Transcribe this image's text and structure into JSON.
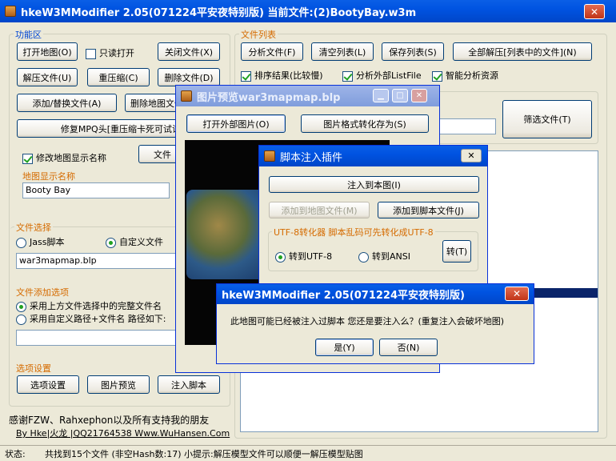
{
  "main": {
    "title": "hkeW3MModifier 2.05(071224平安夜特别版) 当前文件:(2)BootyBay.w3m",
    "close": "✕",
    "func_group": "功能区",
    "open_map": "打开地图(O)",
    "readonly": "只读打开",
    "close_file": "关闭文件(X)",
    "extract_file": "解压文件(U)",
    "recompress": "重压缩(C)",
    "delete_file": "删除文件(D)",
    "add_replace": "添加/替换文件(A)",
    "delete_map_file": "删除地图文件",
    "fix_mpq": "修复MPQ头[重压缩卡死可试试",
    "modify_name": "修改地图显示名称",
    "file_btn": "文件",
    "map_name_label": "地图显示名称",
    "map_name_value": "Booty Bay",
    "file_select_group": "文件选择",
    "jass_script": "Jass脚本",
    "custom_file": "自定义文件",
    "file_select_value": "war3mapmap.blp",
    "add_options_group": "文件添加选项",
    "use_full_name": "采用上方文件选择中的完整文件名",
    "use_custom_path": "采用自定义路径+文件名 路径如下:",
    "options_group": "选项设置",
    "options_btn": "选项设置",
    "image_preview_btn": "图片预览",
    "inject_script_btn": "注入脚本",
    "thanks": "感谢FZW、Rahxephon以及所有支持我的朋友",
    "credit": "By Hke|火龙 |QQ21764538 Www.WuHansen.Com",
    "file_list_group": "文件列表",
    "analyze_file": "分析文件(F)",
    "clear_list": "清空列表(L)",
    "save_list": "保存列表(S)",
    "extract_all": "全部解压[列表中的文件](N)",
    "sort_results": "排序结果(比较慢)",
    "analyze_external": "分析外部ListFile",
    "smart_analyze": "智能分析资源",
    "filter_file": "筛选文件(T)",
    "status_label": "状态:",
    "status_text": "共找到15个文件 (非空Hash数:17) 小提示:解压模型文件可以顺便一解压模型贴图"
  },
  "preview_window": {
    "title": "图片预览war3mapmap.blp",
    "open_external": "打开外部图片(O)",
    "convert_save": "图片格式转化存为(S)"
  },
  "inject_window": {
    "title": "脚本注入插件",
    "inject_to_map": "注入到本图(I)",
    "add_to_map_file": "添加到地图文件(M)",
    "add_to_script_file": "添加到脚本文件(J)",
    "utf8_group": "UTF-8转化器 脚本乱码可先转化成UTF-8",
    "to_utf8": "转到UTF-8",
    "to_ansi": "转到ANSI",
    "convert_btn": "转(T)"
  },
  "dialog": {
    "title": "hkeW3MModifier 2.05(071224平安夜特别版)",
    "message": "此地图可能已经被注入过脚本 您还是要注入么？(重复注入会破坏地图)",
    "yes": "是(Y)",
    "no": "否(N)"
  },
  "colors": {
    "titlebar": "#0054e3",
    "group_label": "#0046d5",
    "selection": "#0a246a"
  }
}
